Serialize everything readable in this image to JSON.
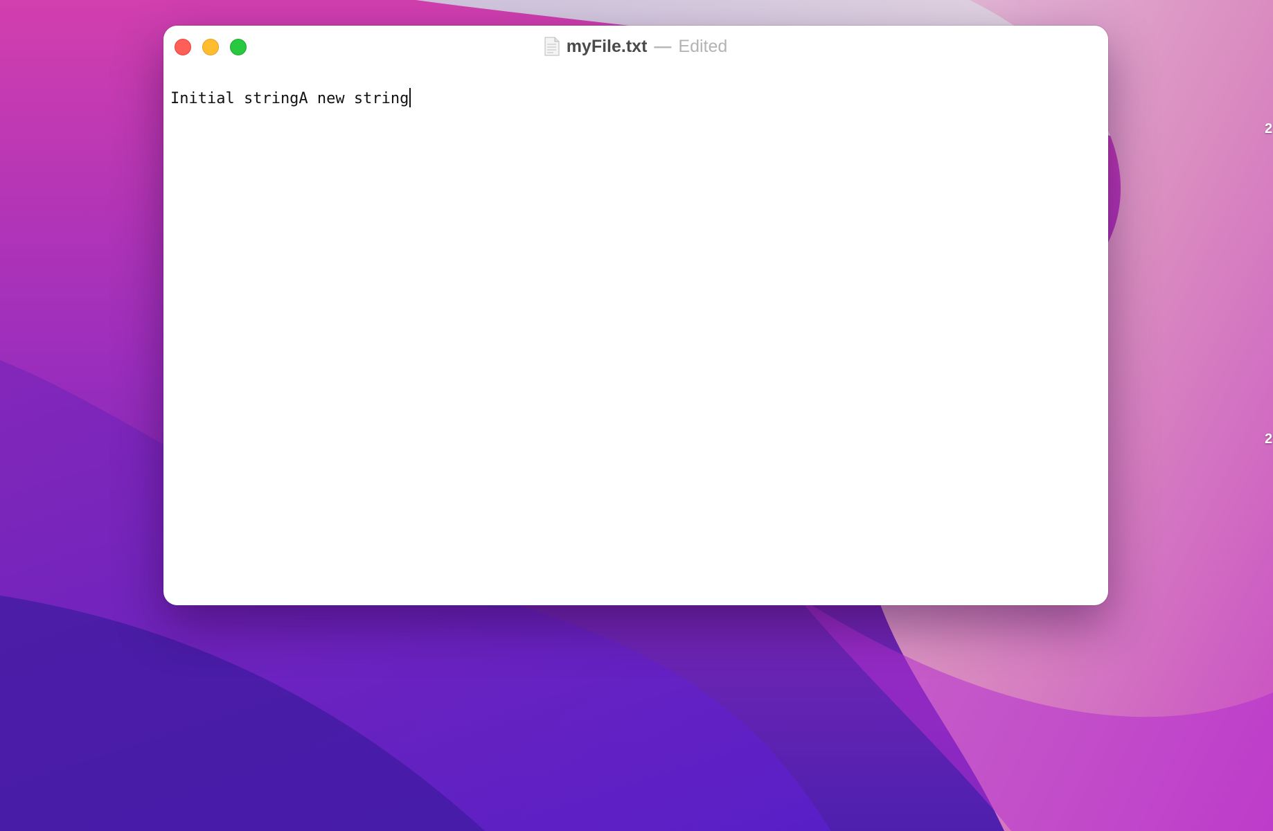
{
  "window": {
    "title": "myFile.txt",
    "title_separator": "—",
    "status": "Edited",
    "document_icon": "text-document-icon"
  },
  "editor": {
    "content": "Initial stringA new string"
  },
  "desktop": {
    "edge_labels": [
      "2",
      "2"
    ]
  },
  "colors": {
    "close": "#fe5f57",
    "minimize": "#febc2e",
    "zoom": "#28c840",
    "wallpaper_pink": "#d44bb2",
    "wallpaper_purple": "#6a23c0"
  }
}
